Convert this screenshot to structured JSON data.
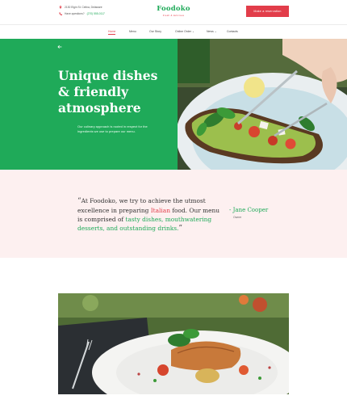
{
  "topbar": {
    "address": "2130 Elgin St. Celina, Delaware",
    "phone_label": "Have questions?",
    "phone_number": "(270) 555-0117"
  },
  "logo": {
    "name": "Foodoko",
    "tagline": "Fresh & delicious"
  },
  "reserve_button": "Make a reservation",
  "nav": {
    "items": [
      {
        "label": "Home"
      },
      {
        "label": "Menu"
      },
      {
        "label": "Our Story"
      },
      {
        "label": "Online Order ⌄"
      },
      {
        "label": "News ⌄"
      },
      {
        "label": "Contacts"
      }
    ]
  },
  "hero": {
    "title_line1": "Unique dishes",
    "title_line2": "& friendly",
    "title_line3": "atmosphere",
    "text": "Our culinary approach is rooted in respect for the ingredients we use to prepare our menu."
  },
  "quote": {
    "part1": "At Foodoko, we try to achieve the utmost excellence in preparing ",
    "highlight_red": "Italian",
    "part2": " food. Our menu is comprised of ",
    "highlight_green": "tasty dishes, mouthwatering desserts, and outstanding drinks.",
    "author": "- Jane Cooper",
    "role": "Owner"
  },
  "colors": {
    "brand_green": "#1faa59",
    "accent_red": "#e23d4a",
    "quote_bg": "#fdf0f0"
  }
}
